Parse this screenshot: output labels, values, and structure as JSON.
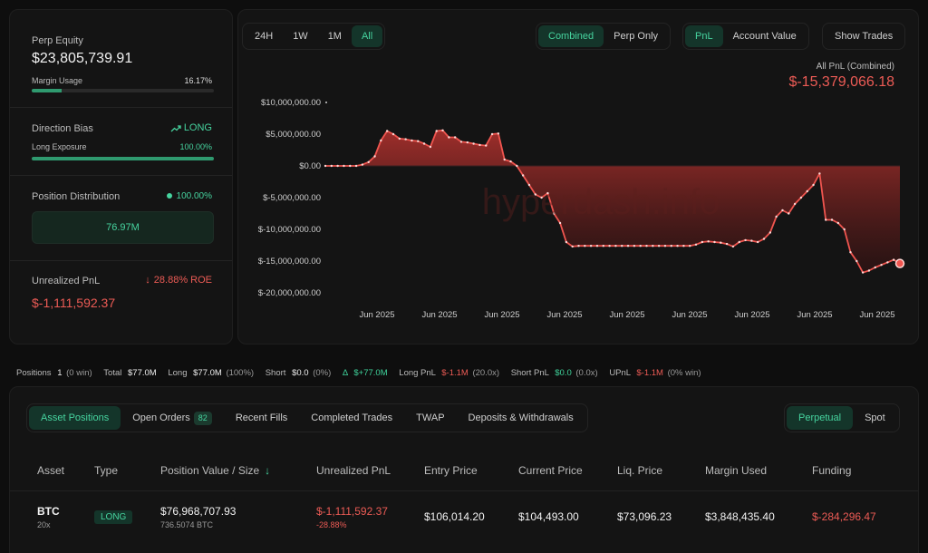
{
  "stats": {
    "perp_equity_label": "Perp Equity",
    "perp_equity": "$23,805,739.91",
    "margin_usage_label": "Margin Usage",
    "margin_usage": "16.17%",
    "margin_usage_frac": 0.1617,
    "direction_bias_label": "Direction Bias",
    "direction_bias": "LONG",
    "long_exposure_label": "Long Exposure",
    "long_exposure": "100.00%",
    "long_exposure_frac": 1.0,
    "position_distribution_label": "Position Distribution",
    "position_distribution_pct": "100.00%",
    "position_value": "76.97M",
    "unrealized_pnl_label": "Unrealized PnL",
    "roe": "28.88% ROE",
    "unrealized_pnl": "$-1,111,592.37"
  },
  "chart_controls": {
    "ranges": [
      "24H",
      "1W",
      "1M",
      "All"
    ],
    "active_range": "All",
    "mode": [
      "Combined",
      "Perp Only"
    ],
    "metric": [
      "PnL",
      "Account Value"
    ],
    "show_trades": "Show Trades"
  },
  "chart_header": {
    "label": "All PnL (Combined)",
    "value": "$-15,379,066.18"
  },
  "watermark": "hyperdash.info",
  "chart_data": {
    "type": "area",
    "ytick_labels": [
      "$10,000,000.00",
      "$5,000,000.00",
      "$0.00",
      "$-5,000,000.00",
      "$-10,000,000.00",
      "$-15,000,000.00",
      "$-20,000,000.00"
    ],
    "ytick_values": [
      10000000,
      5000000,
      0,
      -5000000,
      -10000000,
      -15000000,
      -20000000
    ],
    "xtick_labels": [
      "Jun 2025",
      "Jun 2025",
      "Jun 2025",
      "Jun 2025",
      "Jun 2025",
      "Jun 2025",
      "Jun 2025",
      "Jun 2025",
      "Jun 2025"
    ],
    "ylim": [
      -20000000,
      10000000
    ],
    "series": [
      {
        "values": [
          0,
          0,
          0,
          0,
          0,
          0,
          200000,
          600000,
          1500000,
          4000000,
          5500000,
          5000000,
          4300000,
          4200000,
          4000000,
          3900000,
          3500000,
          3000000,
          5500000,
          5600000,
          4500000,
          4500000,
          3800000,
          3700000,
          3500000,
          3300000,
          3200000,
          5000000,
          5100000,
          1000000,
          700000,
          0,
          -1500000,
          -3000000,
          -4500000,
          -5000000,
          -4300000,
          -7500000,
          -9000000,
          -12000000,
          -12700000,
          -12600000,
          -12600000,
          -12600000,
          -12600000,
          -12600000,
          -12600000,
          -12600000,
          -12600000,
          -12600000,
          -12600000,
          -12600000,
          -12600000,
          -12600000,
          -12600000,
          -12600000,
          -12600000,
          -12600000,
          -12600000,
          -12600000,
          -12400000,
          -12000000,
          -11900000,
          -12000000,
          -12100000,
          -12300000,
          -12700000,
          -12000000,
          -11700000,
          -11800000,
          -12000000,
          -11500000,
          -10500000,
          -8000000,
          -7000000,
          -7500000,
          -6000000,
          -5000000,
          -4000000,
          -3000000,
          -1200000,
          -8500000,
          -8500000,
          -9000000,
          -10000000,
          -13600000,
          -15000000,
          -16800000,
          -16500000,
          -16000000,
          -15600000,
          -15200000,
          -14800000,
          -15379066
        ]
      }
    ]
  },
  "summary": {
    "positions_label": "Positions",
    "positions_count": "1",
    "positions_win": "(0 win)",
    "total_label": "Total",
    "total": "$77.0M",
    "long_label": "Long",
    "long": "$77.0M",
    "long_pct": "(100%)",
    "short_label": "Short",
    "short": "$0.0",
    "short_pct": "(0%)",
    "delta_label": "Δ",
    "delta": "$+77.0M",
    "long_pnl_label": "Long PnL",
    "long_pnl": "$-1.1M",
    "long_pnl_x": "(20.0x)",
    "short_pnl_label": "Short PnL",
    "short_pnl": "$0.0",
    "short_pnl_x": "(0.0x)",
    "upnl_label": "UPnL",
    "upnl": "$-1.1M",
    "upnl_win": "(0% win)"
  },
  "table_tabs": {
    "asset_positions": "Asset Positions",
    "open_orders": "Open Orders",
    "open_orders_count": "82",
    "recent_fills": "Recent Fills",
    "completed_trades": "Completed Trades",
    "twap": "TWAP",
    "deposits": "Deposits & Withdrawals",
    "perpetual": "Perpetual",
    "spot": "Spot"
  },
  "table": {
    "headers": [
      "Asset",
      "Type",
      "Position Value / Size",
      "Unrealized PnL",
      "Entry Price",
      "Current Price",
      "Liq. Price",
      "Margin Used",
      "Funding"
    ],
    "row": {
      "asset": "BTC",
      "leverage": "20x",
      "type": "LONG",
      "position_value": "$76,968,707.93",
      "size": "736.5074 BTC",
      "unrealized_pnl": "$-1,111,592.37",
      "pnl_pct": "-28.88%",
      "entry_price": "$106,014.20",
      "current_price": "$104,493.00",
      "liq_price": "$73,096.23",
      "margin_used": "$3,848,435.40",
      "funding": "$-284,296.47"
    }
  }
}
